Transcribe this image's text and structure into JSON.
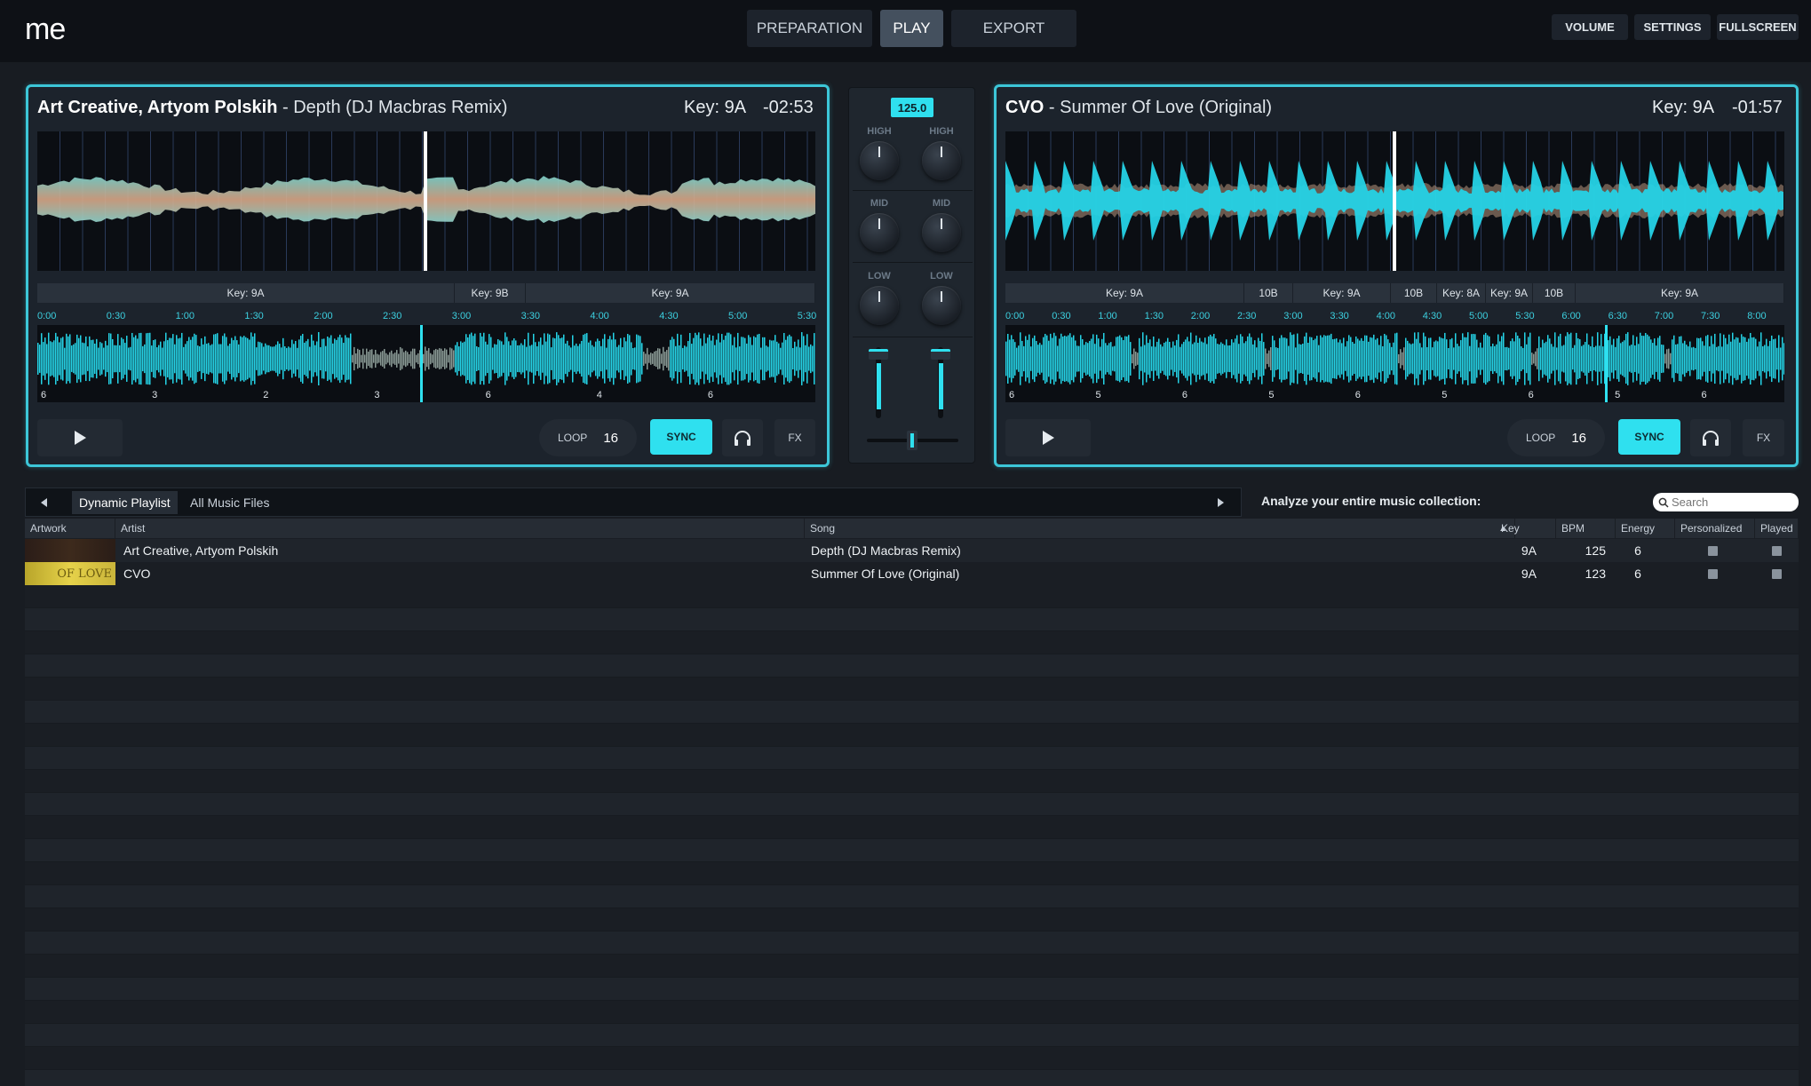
{
  "app": {
    "logo": "me"
  },
  "nav": {
    "tabs": [
      {
        "label": "PREPARATION"
      },
      {
        "label": "PLAY"
      },
      {
        "label": "EXPORT"
      }
    ],
    "active": "PLAY"
  },
  "top_right": {
    "volume": "VOLUME",
    "settings": "SETTINGS",
    "fullscreen": "FULLSCREEN"
  },
  "colors": {
    "accent": "#2fe0ef",
    "deck_border": "#3cc6d8",
    "background": "#181c22",
    "wave_warm": "#c9a38a"
  },
  "deck_a": {
    "artist": "Art Creative, Artyom Polskih",
    "title": " - Depth (DJ Macbras Remix)",
    "key": "Key: 9A",
    "time": "-02:53",
    "key_segments": [
      {
        "label": "Key: 9A"
      },
      {
        "label": "Key: 9B"
      },
      {
        "label": "Key: 9A"
      }
    ],
    "time_ticks": [
      "0:00",
      "0:30",
      "1:00",
      "1:30",
      "2:00",
      "2:30",
      "3:00",
      "3:30",
      "4:00",
      "4:30",
      "5:00",
      "5:30"
    ],
    "energy_markers": [
      "6",
      "3",
      "2",
      "3",
      "6",
      "4",
      "6"
    ],
    "loop_label": "LOOP",
    "loop_value": "16",
    "sync_label": "SYNC",
    "fx_label": "FX",
    "playhead_fraction": 0.5
  },
  "deck_b": {
    "artist": "CVO",
    "title": " - Summer Of Love (Original)",
    "key": "Key: 9A",
    "time": "-01:57",
    "key_segments": [
      {
        "label": "Key: 9A"
      },
      {
        "label": "10B"
      },
      {
        "label": "Key: 9A"
      },
      {
        "label": "10B"
      },
      {
        "label": "Key: 8A"
      },
      {
        "label": "Key: 9A"
      },
      {
        "label": "10B"
      },
      {
        "label": "Key: 9A"
      }
    ],
    "time_ticks": [
      "0:00",
      "0:30",
      "1:00",
      "1:30",
      "2:00",
      "2:30",
      "3:00",
      "3:30",
      "4:00",
      "4:30",
      "5:00",
      "5:30",
      "6:00",
      "6:30",
      "7:00",
      "7:30",
      "8:00"
    ],
    "energy_markers": [
      "6",
      "5",
      "6",
      "5",
      "6",
      "5",
      "6",
      "5",
      "6"
    ],
    "loop_label": "LOOP",
    "loop_value": "16",
    "sync_label": "SYNC",
    "fx_label": "FX",
    "playhead_fraction": 0.5
  },
  "mixer": {
    "bpm": "125.0",
    "high": "HIGH",
    "mid": "MID",
    "low": "LOW",
    "crossfader_position": 0.5
  },
  "library": {
    "tabs": [
      {
        "label": "Dynamic Playlist"
      },
      {
        "label": "All Music Files"
      }
    ],
    "analyze_text": "Analyze your entire music collection:",
    "search_placeholder": "Search",
    "columns": [
      "Artwork",
      "Artist",
      "Song",
      "Key",
      "BPM",
      "Energy",
      "Personalized",
      "Played"
    ],
    "sort_indicator": "▲",
    "rows": [
      {
        "artist": "Art Creative, Artyom Polskih",
        "song": "Depth (DJ Macbras Remix)",
        "key": "9A",
        "bpm": "125",
        "energy": "6"
      },
      {
        "artist": "CVO",
        "song": "Summer Of Love (Original)",
        "key": "9A",
        "bpm": "123",
        "energy": "6",
        "artwork_text": "OF LOVE"
      }
    ]
  }
}
